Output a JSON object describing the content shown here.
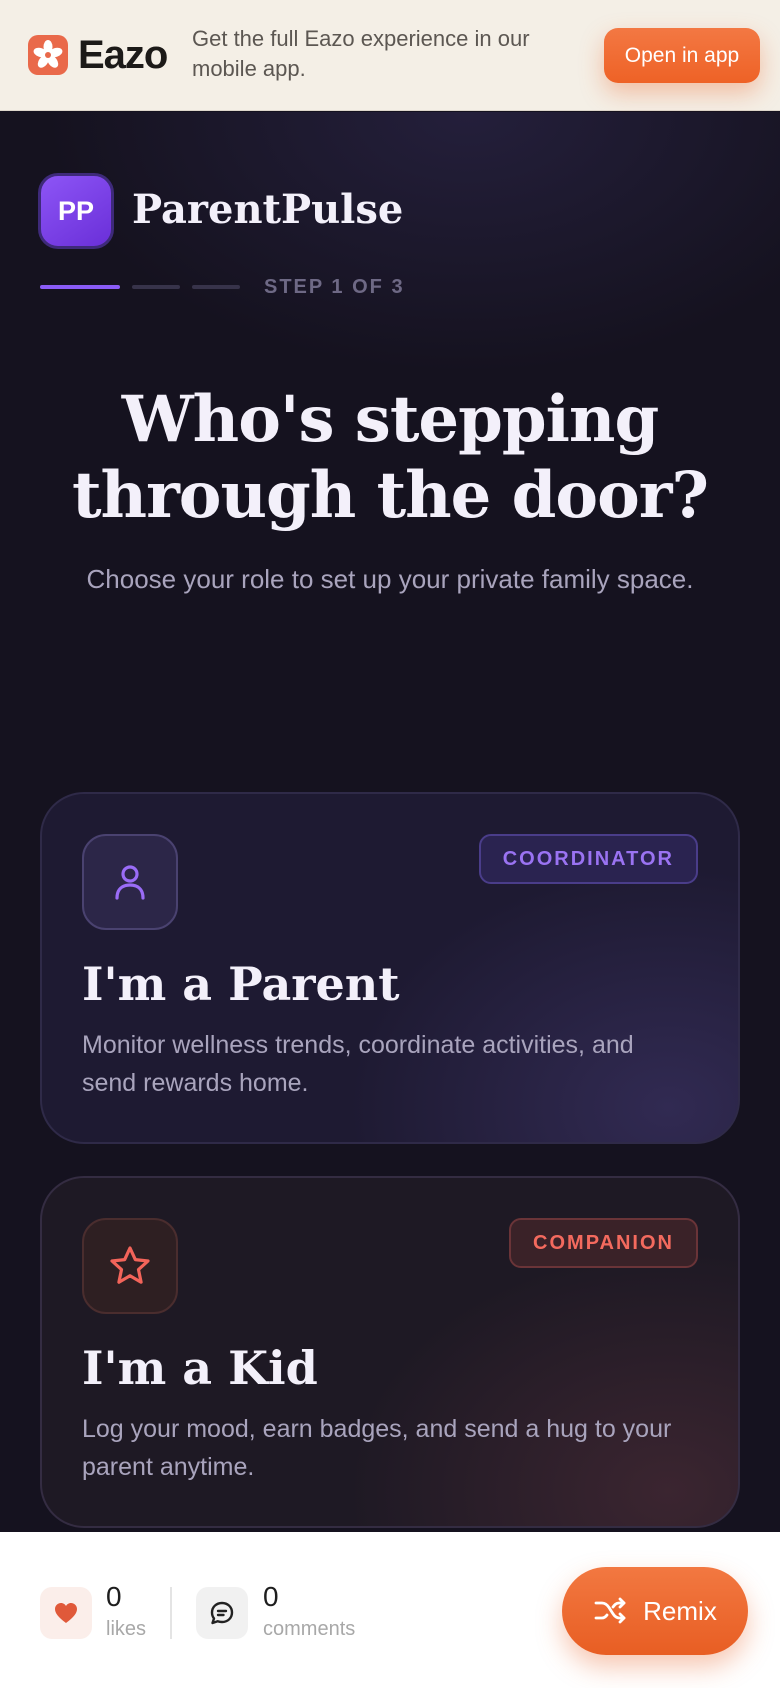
{
  "banner": {
    "brand": "Eazo",
    "message": "Get the full Eazo experience in our mobile app.",
    "cta_label": "Open in app",
    "logo_icon": "eazo-asterisk-icon"
  },
  "app": {
    "badge_initials": "PP",
    "name": "ParentPulse"
  },
  "progress": {
    "label": "STEP 1 OF 3",
    "current_step": 1,
    "total_steps": 3
  },
  "hero": {
    "title": "Who's stepping through the door?",
    "subtitle": "Choose your role to set up your private family space."
  },
  "roles": [
    {
      "icon": "user-icon",
      "tag": "COORDINATOR",
      "title": "I'm a Parent",
      "description": "Monitor wellness trends, coordinate activities, and send rewards home.",
      "accent": "#8a5cf6"
    },
    {
      "icon": "star-icon",
      "tag": "COMPANION",
      "title": "I'm a Kid",
      "description": "Log your mood, earn badges, and send a hug to your parent anytime.",
      "accent": "#f36a5e"
    }
  ],
  "footer": {
    "likes_count": "0",
    "likes_label": "likes",
    "comments_count": "0",
    "comments_label": "comments",
    "remix_label": "Remix",
    "like_icon": "heart-icon",
    "comment_icon": "comment-icon",
    "remix_icon": "shuffle-icon"
  },
  "colors": {
    "brand_orange": "#ee6226",
    "accent_purple": "#8a5cf6",
    "background": "#15121f"
  }
}
